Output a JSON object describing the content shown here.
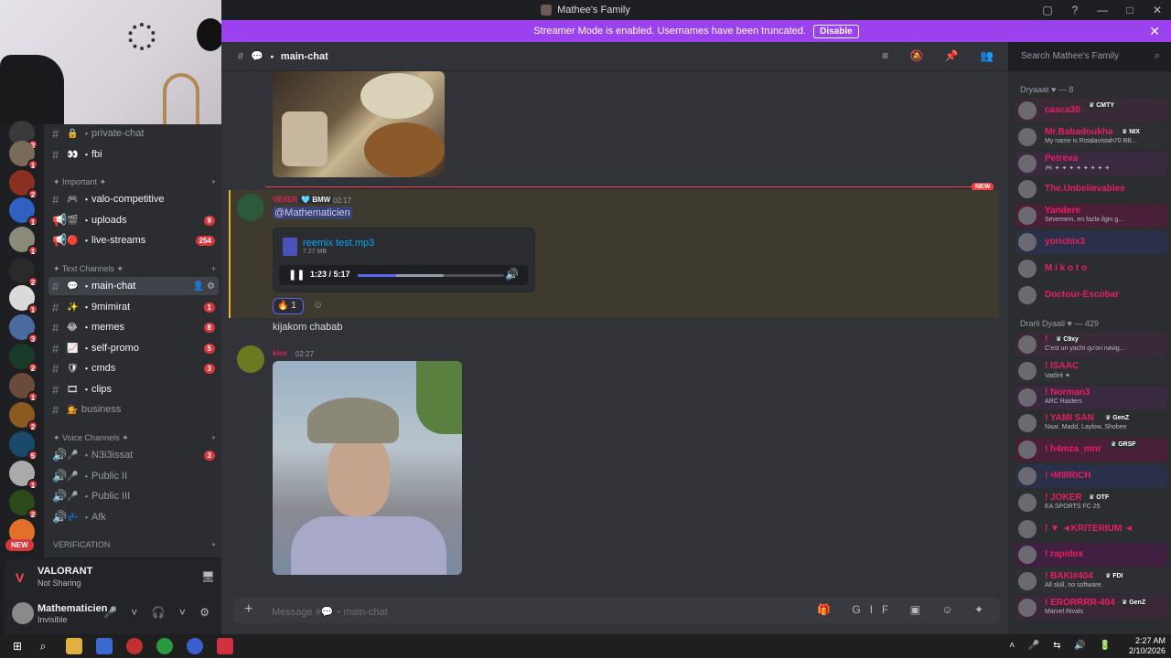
{
  "window": {
    "title": "Mathee's Family"
  },
  "banner": {
    "text": "Streamer Mode is enabled. Usernames have been truncated.",
    "button": "Disable"
  },
  "servers": {
    "badges": [
      "2",
      "1",
      "2",
      "1",
      "1",
      "2",
      "1",
      "3",
      "2",
      "1",
      "2",
      "5",
      "1",
      "2"
    ],
    "new_pill": "NEW"
  },
  "channels": {
    "items": [
      {
        "emoji": "🔒",
        "name": "private-chat",
        "badge": ""
      },
      {
        "emoji": "👀",
        "name": "fbi",
        "badge": ""
      }
    ],
    "cat_important": "✦ Important ✦",
    "important": [
      {
        "emoji": "🎮",
        "name": "valo-competitive",
        "badge": ""
      },
      {
        "emoji": "🎬",
        "name": "uploads",
        "badge": "9"
      },
      {
        "emoji": "🔴",
        "name": "live-streams",
        "badge": "254"
      }
    ],
    "cat_text": "✦ Text Channels ✦",
    "text": [
      {
        "emoji": "💬",
        "name": "main-chat",
        "badge": ""
      },
      {
        "emoji": "✨",
        "name": "9mimirat",
        "badge": "1"
      },
      {
        "emoji": "😂",
        "name": "memes",
        "badge": "8"
      },
      {
        "emoji": "📈",
        "name": "self-promo",
        "badge": "5"
      },
      {
        "emoji": "🛡",
        "name": "cmds",
        "badge": "3"
      },
      {
        "emoji": "🎞",
        "name": "clips",
        "badge": ""
      },
      {
        "emoji": "💁",
        "name": "business",
        "badge": ""
      }
    ],
    "cat_voice": "✦ Voice Channels ✦",
    "voice": [
      {
        "emoji": "🎤",
        "name": "N3i3issat",
        "badge": "3"
      },
      {
        "emoji": "🎤",
        "name": "Public II",
        "badge": ""
      },
      {
        "emoji": "🎤",
        "name": "Public III",
        "badge": ""
      },
      {
        "emoji": "💤",
        "name": "Afk",
        "badge": ""
      }
    ],
    "cat_verification": "VERIFICATION"
  },
  "activity": {
    "game": "VALORANT",
    "status": "Not Sharing"
  },
  "user": {
    "name": "Mathematicien",
    "status": "Invisible"
  },
  "chat": {
    "channel": "main-chat",
    "search_placeholder": "Search Mathee's Family",
    "new_label": "NEW",
    "msg1": {
      "author": "VEXER",
      "tag": "BMW",
      "time": "02:17",
      "mention": "@Mathematicien",
      "file_name": "reemix test.mp3",
      "file_size": "7.27 MB",
      "audio_time": "1:23 / 5:17",
      "audio_progress": 0.26,
      "audio_buffered": 0.59,
      "reaction_emoji": "🔥",
      "reaction_count": "1"
    },
    "msg2": {
      "text": "kijakom chabab"
    },
    "msg3": {
      "author": "kiss",
      "time": "02:27"
    },
    "composer_placeholder": "Message #💬・main-chat"
  },
  "members": {
    "group1": "Dryaaat ♥ — 8",
    "group1_list": [
      {
        "name": "casca30",
        "tag": "CMTY",
        "activity": "",
        "color": "#e91e63"
      },
      {
        "name": "Mr.Babadoukha",
        "tag": "NIX",
        "activity": "My name is Rstalavistah70 BB...",
        "color": "#e91e63"
      },
      {
        "name": "Petreva",
        "tag": "",
        "activity": "🎮 ✦ ✦ ✦ ✦ ✦ ✦ ✦ ✦",
        "color": "#e91e63"
      },
      {
        "name": "The.Unbelievablee",
        "tag": "",
        "activity": "",
        "color": "#e91e63"
      },
      {
        "name": "Yandere",
        "tag": "",
        "activity": "Sevemem, en fazla ilgin g...",
        "color": "#e91e63"
      },
      {
        "name": "yorichix3",
        "tag": "",
        "activity": "",
        "color": "#e91e63"
      },
      {
        "name": "M i k o t o",
        "tag": "",
        "activity": "",
        "color": "#e91e63"
      },
      {
        "name": "Doctour-Escobar",
        "tag": "",
        "activity": "",
        "color": "#e91e63"
      }
    ],
    "group2": "Drarli Dyaali ♥ — 429",
    "group2_list": [
      {
        "name": "!",
        "tag": "C9xy",
        "activity": "C'est un yacht qu'on navig...",
        "color": "#e91e63"
      },
      {
        "name": "! ISAAC",
        "tag": "",
        "activity": "Vatőré ✦",
        "color": "#e91e63"
      },
      {
        "name": "! Norman3",
        "tag": "",
        "activity": "ARC Raiders",
        "color": "#e91e63"
      },
      {
        "name": "! YAMI SAN",
        "tag": "GenZ",
        "activity": "Naar, Madd, Laylow, Shobee",
        "color": "#e91e63"
      },
      {
        "name": "! h4mza_mnr",
        "tag": "GRSF",
        "activity": "",
        "color": "#e91e63"
      },
      {
        "name": "! •M9IRICH",
        "tag": "",
        "activity": "",
        "color": "#e91e63"
      },
      {
        "name": "! JOKER",
        "tag": "OTF",
        "activity": "EA SPORTS FC 25",
        "color": "#e91e63"
      },
      {
        "name": "! ▼ ◄KRITERIUM ◄",
        "tag": "",
        "activity": "",
        "color": "#e91e63"
      },
      {
        "name": "! rapidox",
        "tag": "",
        "activity": "",
        "color": "#e91e63"
      },
      {
        "name": "! BAKI#404",
        "tag": "FDI",
        "activity": "All skill, no software.",
        "color": "#e91e63"
      },
      {
        "name": "! ERORRRR-404",
        "tag": "GenZ",
        "activity": "Marvel Rivals",
        "color": "#e91e63"
      }
    ]
  },
  "taskbar": {
    "time": "2:27 AM",
    "date": "2/10/2026",
    "notif": "7"
  }
}
